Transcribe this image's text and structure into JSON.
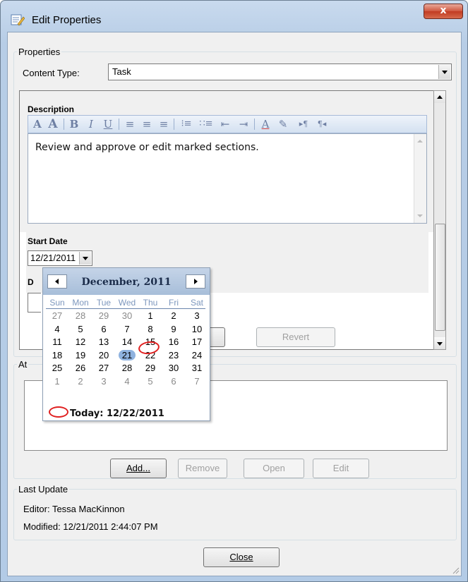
{
  "window": {
    "title": "Edit Properties",
    "close_glyph": "x"
  },
  "properties": {
    "legend": "Properties",
    "content_type_label": "Content Type:",
    "content_type_value": "Task",
    "description_label": "Description",
    "description_text": "Review and approve or edit marked sections.",
    "start_date_label": "Start Date",
    "start_date_value": "12/21/2011",
    "due_date_label_partial": "D"
  },
  "toolbar": [
    "font-size-down-icon",
    "font-size-up-icon",
    "bold-icon",
    "italic-icon",
    "underline-icon",
    "align-left-icon",
    "align-center-icon",
    "align-right-icon",
    "numbered-list-icon",
    "bullet-list-icon",
    "outdent-icon",
    "indent-icon",
    "font-color-icon",
    "highlight-icon",
    "ltr-icon",
    "rtl-icon"
  ],
  "toolbar_glyphs": {
    "bold": "B",
    "italic": "I",
    "underline": "U",
    "font_down": "A",
    "font_up": "A",
    "align_left": "≡",
    "align_center": "≡",
    "align_right": "≡",
    "numbered": "⁝≡",
    "bullets": "∷≡",
    "outdent": "⇤",
    "indent": "⇥",
    "font_color": "A",
    "highlight": "✎",
    "ltr": "▸¶",
    "rtl": "¶◂"
  },
  "buttons": {
    "save_partial": "",
    "revert": "Revert",
    "add": "Add...",
    "remove": "Remove",
    "open": "Open",
    "edit": "Edit",
    "close": "Close"
  },
  "attachments": {
    "legend_partial": "At"
  },
  "last_update": {
    "legend": "Last Update",
    "editor": "Editor: Tessa MacKinnon",
    "modified": "Modified: 12/21/2011 2:44:07 PM"
  },
  "calendar": {
    "month": "December, 2011",
    "dow": [
      "Sun",
      "Mon",
      "Tue",
      "Wed",
      "Thu",
      "Fri",
      "Sat"
    ],
    "weeks": [
      [
        "27",
        "28",
        "29",
        "30",
        "1",
        "2",
        "3"
      ],
      [
        "4",
        "5",
        "6",
        "7",
        "8",
        "9",
        "10"
      ],
      [
        "11",
        "12",
        "13",
        "14",
        "15",
        "16",
        "17"
      ],
      [
        "18",
        "19",
        "20",
        "21",
        "22",
        "23",
        "24"
      ],
      [
        "25",
        "26",
        "27",
        "28",
        "29",
        "30",
        "31"
      ],
      [
        "1",
        "2",
        "3",
        "4",
        "5",
        "6",
        "7"
      ]
    ],
    "selected": "21",
    "today": "22",
    "today_text": "Today: 12/22/2011"
  }
}
